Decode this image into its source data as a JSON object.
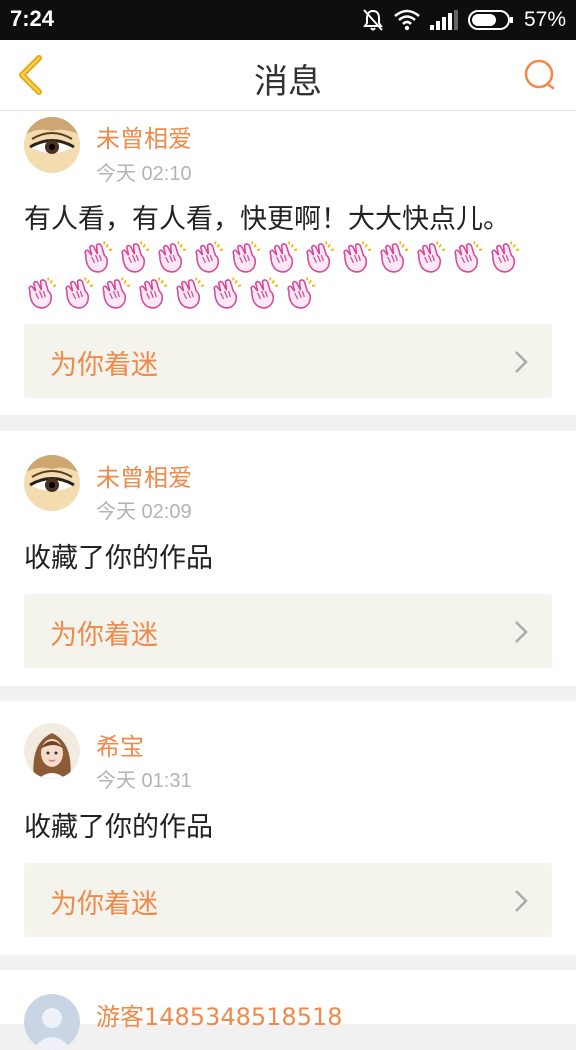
{
  "status": {
    "time": "7:24",
    "battery": "57%"
  },
  "header": {
    "title": "消息"
  },
  "messages": [
    {
      "user": "未曾相爱",
      "time": "今天 02:10",
      "text": "有人看，有人看，快更啊！大大快点儿。",
      "claps": 20,
      "work_title": "为你着迷",
      "avatar": "eye-avatar"
    },
    {
      "user": "未曾相爱",
      "time": "今天 02:09",
      "text": "收藏了你的作品",
      "work_title": "为你着迷",
      "avatar": "eye-avatar"
    },
    {
      "user": "希宝",
      "time": "今天 01:31",
      "text": "收藏了你的作品",
      "work_title": "为你着迷",
      "avatar": "girl-avatar"
    },
    {
      "user": "游客1485348518518",
      "avatar": "guest-avatar"
    }
  ],
  "colors": {
    "accent": "#f0894a",
    "back_arrow": "#f2b81c",
    "card_bg": "#f4f3ec"
  }
}
